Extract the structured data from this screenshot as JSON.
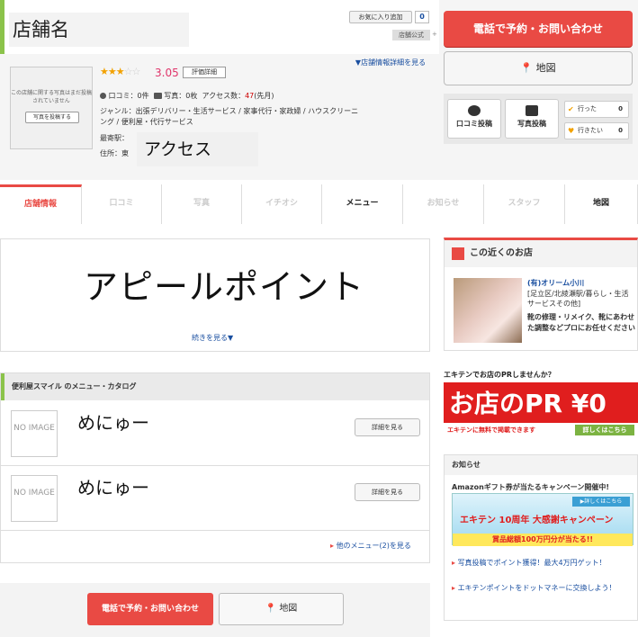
{
  "header": {
    "shop_name": "店舗名",
    "favorite_label": "お気に入り追加",
    "favorite_count": "0",
    "official_label": "店舗公式",
    "official_arrow": "+",
    "call_button": "電話で予約・お問い合わせ",
    "map_button": "地図",
    "map_pin": "⬤"
  },
  "profile": {
    "photo_note": "この店舗に関する写真はまだ投稿されていません",
    "photo_button": "写真を投稿する",
    "stars_filled": "★★★",
    "stars_empty": "☆☆",
    "rating": "3.05",
    "eval_button": "評価詳細",
    "detail_link": "▼店舗情報詳細を見る",
    "review_label": "口コミ：0件",
    "photo_label": "写真：0枚",
    "access_label": "アクセス数：",
    "access_value": "47",
    "access_suffix": "(先月)",
    "genre": "ジャンル：出張デリバリー・生活サービス / 家事代行・家政婦 / ハウスクリーニング / 便利屋・代行サービス",
    "station": "最寄駅：",
    "address": "住所：東",
    "access_overlay": "アクセス"
  },
  "actions": {
    "review_post": "口コミ投稿",
    "photo_post": "写真投稿",
    "went_label": "行った",
    "went_count": "0",
    "want_label": "行きたい",
    "want_count": "0"
  },
  "tabs": [
    "店舗情報",
    "口コミ",
    "写真",
    "イチオシ",
    "メニュー",
    "お知らせ",
    "スタッフ",
    "地図"
  ],
  "appeal": {
    "title": "アピールポイント",
    "more": "続きを見る▼"
  },
  "menu": {
    "heading": "便利屋スマイル のメニュー・カタログ",
    "items": [
      {
        "image": "NO IMAGE",
        "name": "めにゅー",
        "button": "詳細を見る"
      },
      {
        "image": "NO IMAGE",
        "name": "めにゅー",
        "button": "詳細を見る"
      }
    ],
    "other_link": "他のメニュー(2)を見る"
  },
  "bottom": {
    "call_button": "電話で予約・お問い合わせ",
    "map_button": "地図"
  },
  "nearby": {
    "heading": "この近くのお店",
    "shop_title": "(有)オリーム小川",
    "shop_area": "[足立区/北綾瀬駅/暮らし・生活サービスその他]",
    "shop_desc": "靴の修理・リメイク、靴にあわせた調整などプロにお任せください"
  },
  "pr": {
    "question": "エキテンでお店のPRしませんか？",
    "big": "お店のPR ¥0",
    "sub": "エキテンに無料で掲載できます",
    "more": "詳しくはこちら"
  },
  "news": {
    "heading": "お知らせ",
    "campaign_title": "Amazonギフト券が当たるキャンペーン開催中!",
    "banner_detail": "▶詳しくはこちら",
    "banner_main": "エキテン 10周年 大感謝キャンペーン",
    "banner_foot": "賞品総額100万円分が当たる!!",
    "line1": "写真投稿でポイント獲得！最大4万円ゲット！",
    "line2": "エキテンポイントをドットマネーに交換しよう！"
  }
}
